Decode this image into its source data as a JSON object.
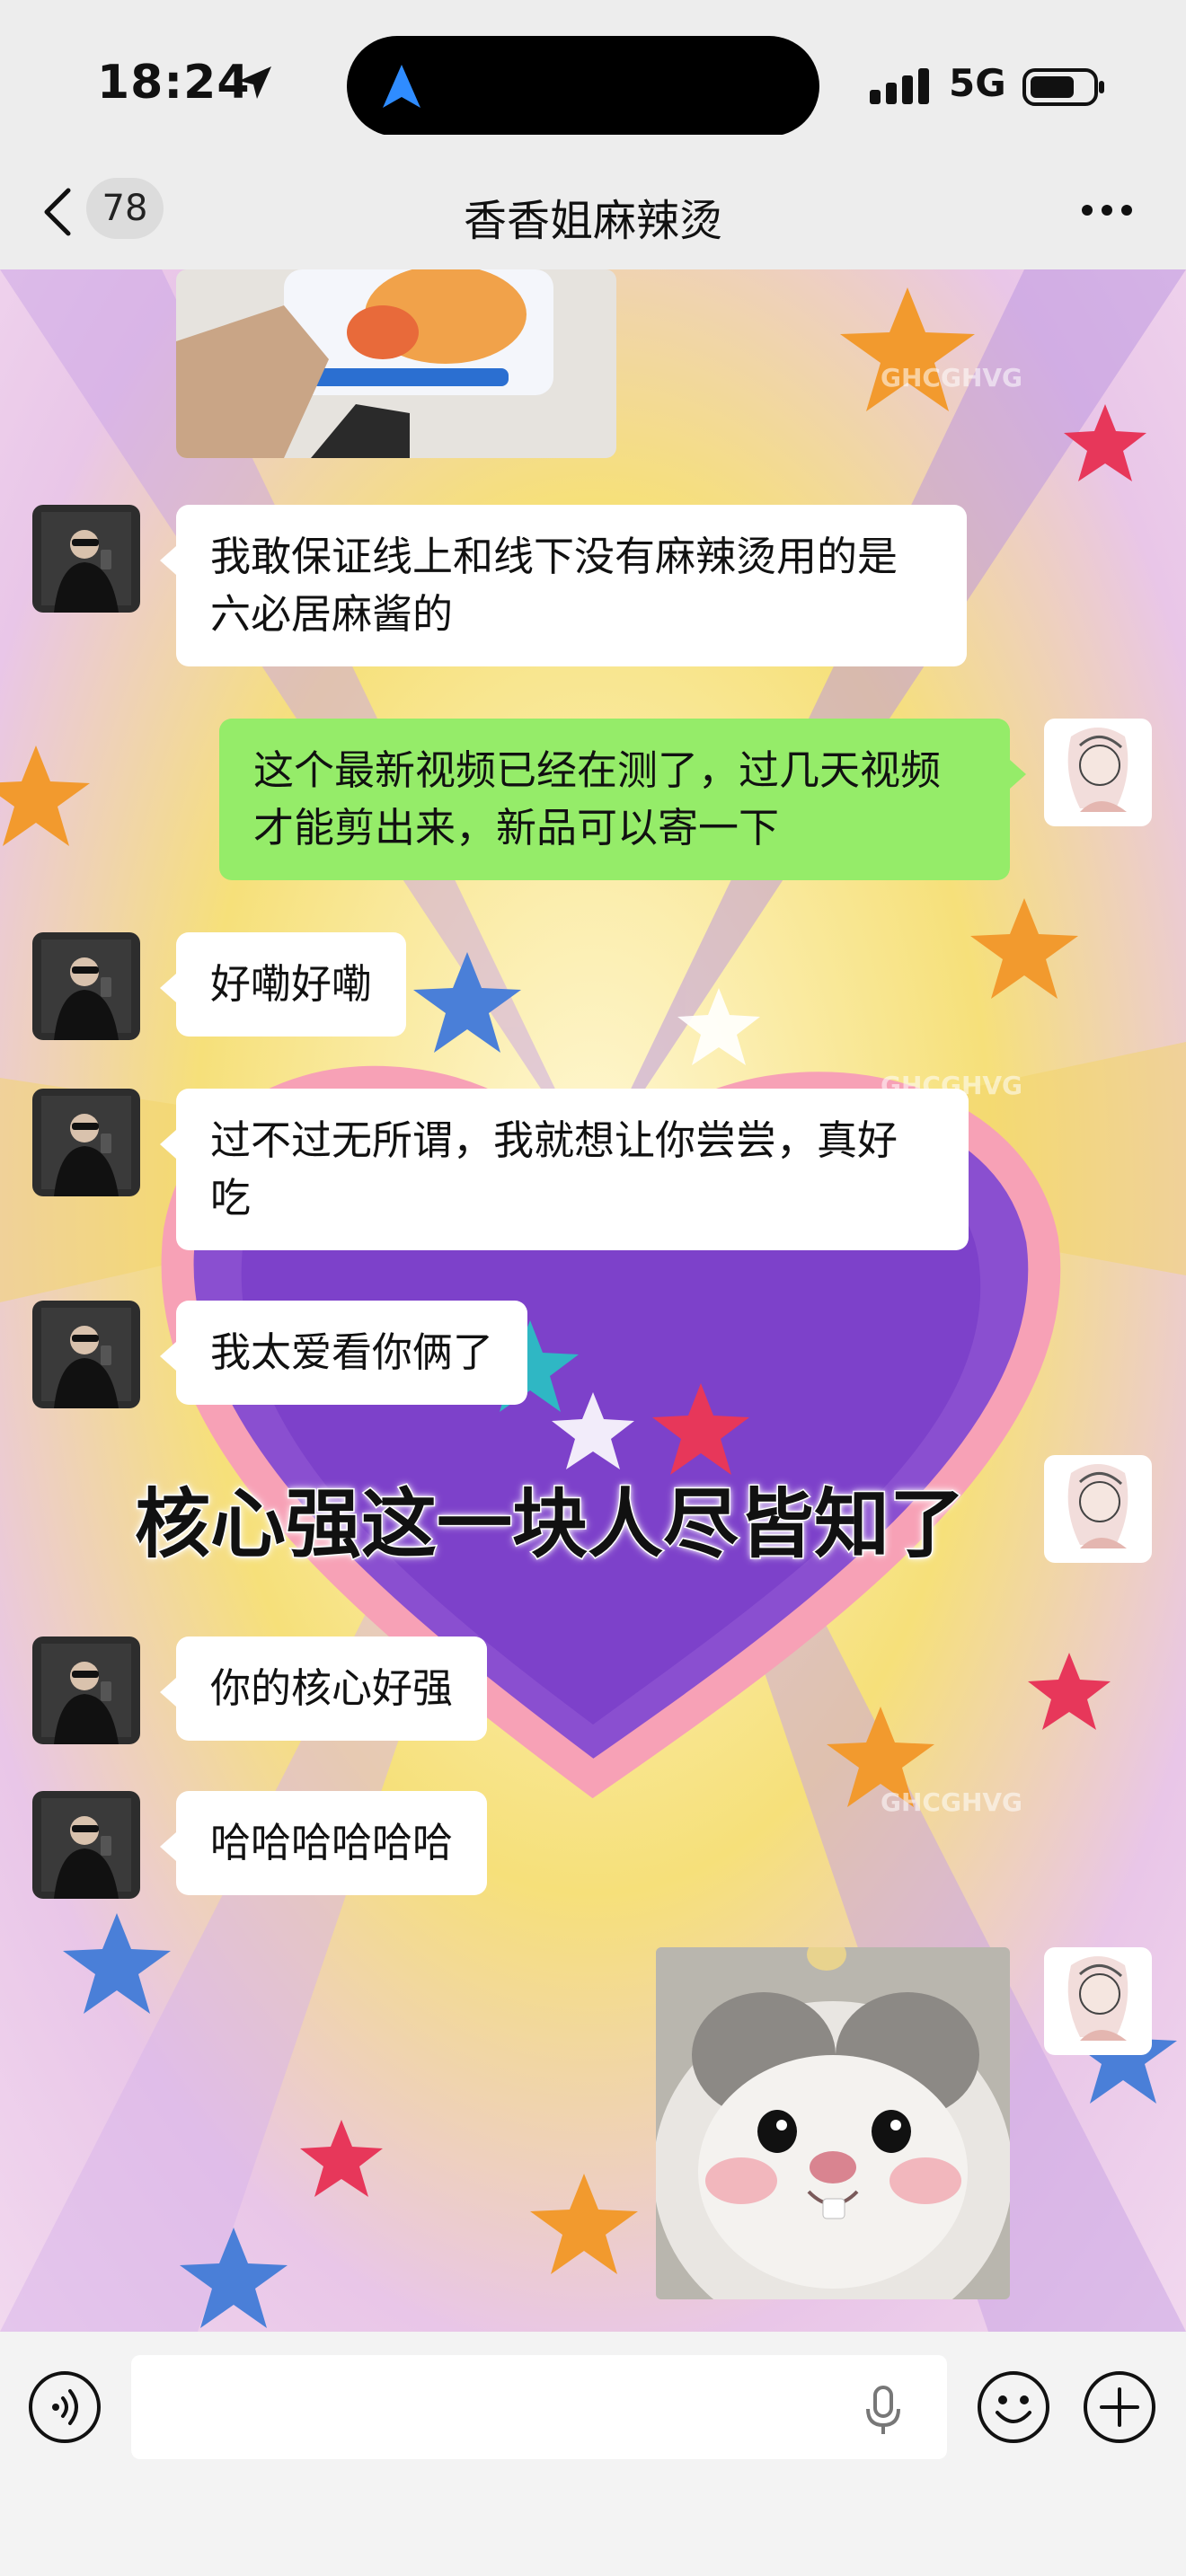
{
  "status_bar": {
    "time": "18:24",
    "network": "5G"
  },
  "nav": {
    "unread_count": "78",
    "title": "香香姐麻辣烫"
  },
  "messages": [
    {
      "side": "left",
      "text": "我敢保证线上和线下没有麻辣烫用的是六必居麻酱的"
    },
    {
      "side": "right",
      "text": "这个最新视频已经在测了，过几天视频才能剪出来，新品可以寄一下"
    },
    {
      "side": "left",
      "text": "好嘞好嘞"
    },
    {
      "side": "left",
      "text": "过不过无所谓，我就想让你尝尝，真好吃"
    },
    {
      "side": "left",
      "text": "我太爱看你俩了"
    },
    {
      "side": "right",
      "type": "sticker",
      "text": "核心强这一块人尽皆知了"
    },
    {
      "side": "left",
      "text": "你的核心好强"
    },
    {
      "side": "left",
      "text": "哈哈哈哈哈哈"
    },
    {
      "side": "right",
      "type": "sticker-image",
      "icon": "hamster-sticker"
    }
  ],
  "wallpaper": {
    "watermark": "GHCGHVG"
  },
  "colors": {
    "self_bubble": "#95ec69",
    "other_bubble": "#ffffff",
    "bar": "#ededed"
  }
}
